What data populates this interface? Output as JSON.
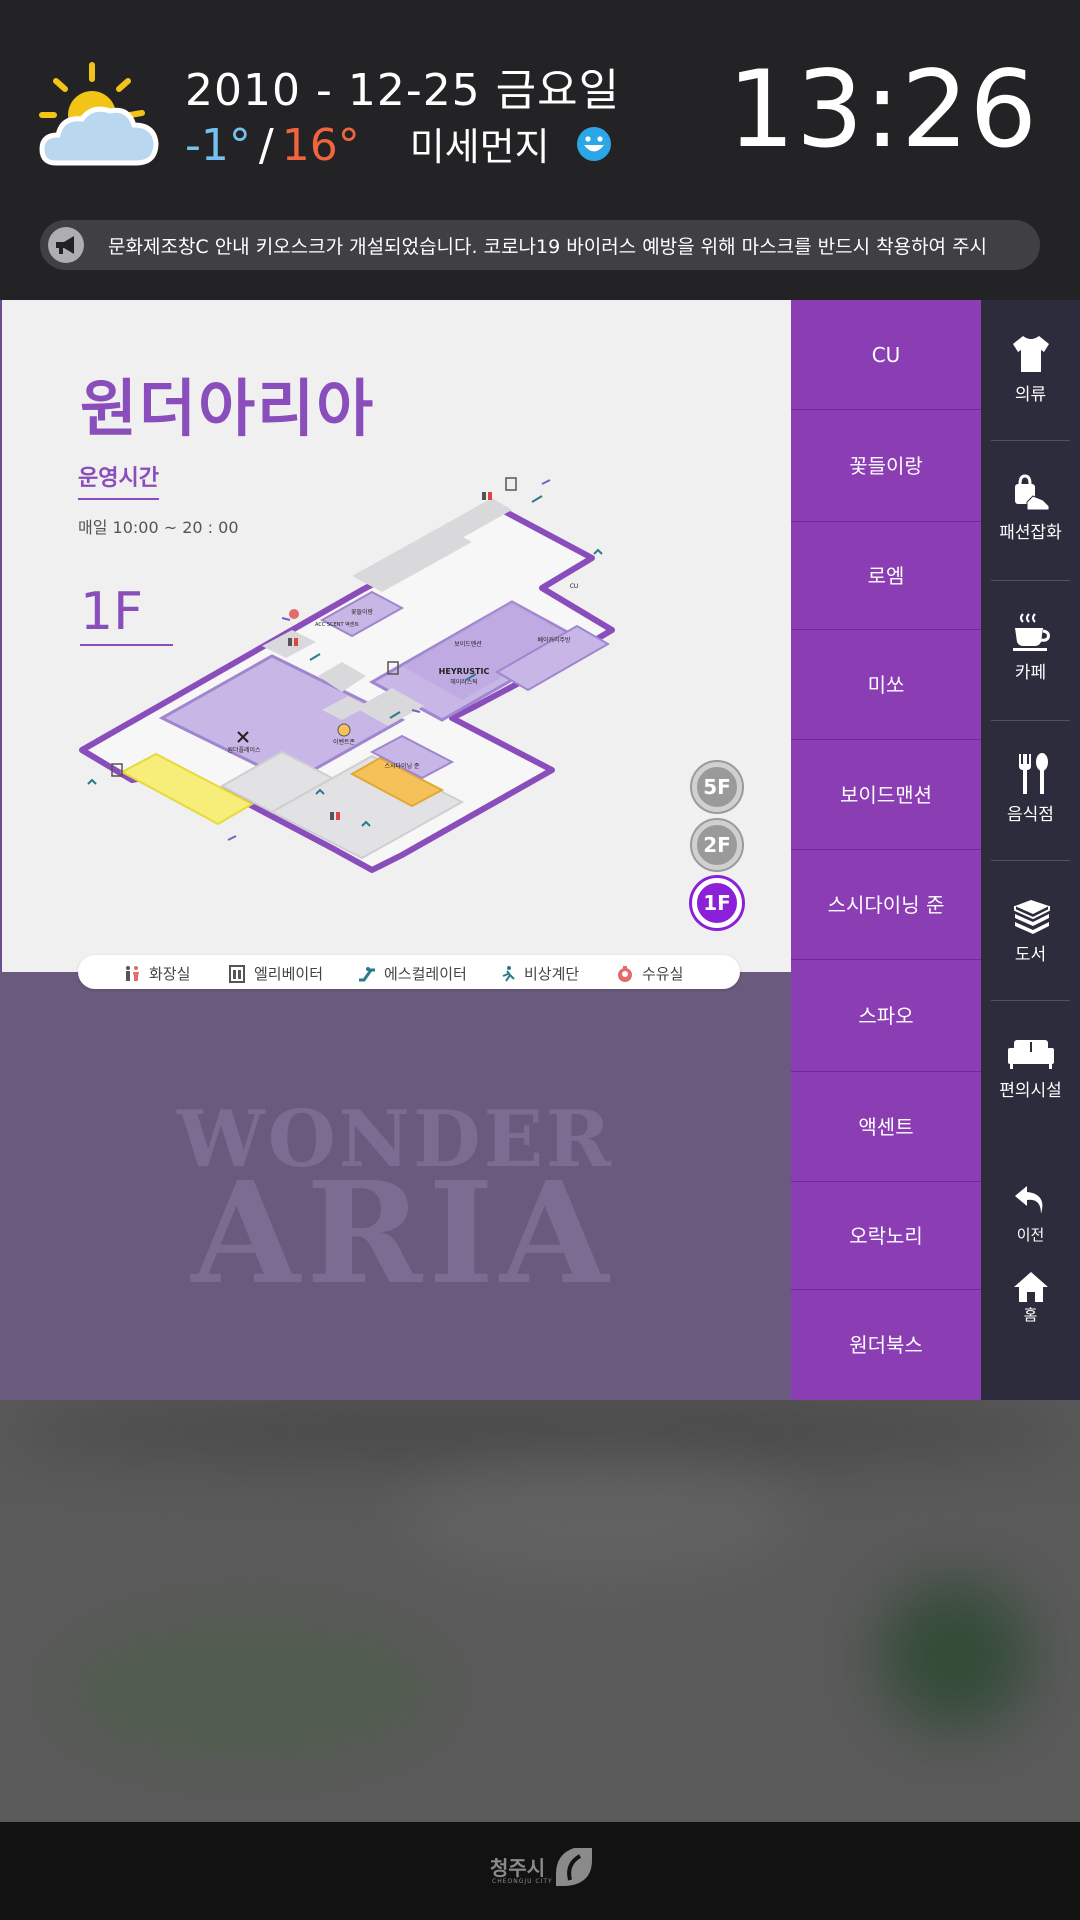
{
  "header": {
    "date": "2010 - 12-25  금요일",
    "temp_low": "-1°",
    "temp_sep": "/",
    "temp_high": "16°",
    "dust_label": "미세먼지",
    "clock": "13:26",
    "notice": "문화제조창C 안내 키오스크가 개설되었습니다. 코로나19 바이러스 예방을 위해 마스크를 반드시 착용하여 주시"
  },
  "shop": {
    "title": "원더아리아",
    "hours_label": "운영시간",
    "hours_value": "매일 10:00 ~ 20 : 00",
    "floor": "1F"
  },
  "map": {
    "labels": {
      "wonder_place": "원더플레이스",
      "boid": "보이드맨션",
      "heyrustic_logo": "HEYRUSTIC",
      "heyrustic": "헤이러스틱",
      "bakery": "베이커리주방",
      "cu": "CU",
      "flower": "꽃들이랑",
      "accent": "ACC SCENT 액센트",
      "event": "이벤트존",
      "sushi": "스시다이닝 준"
    }
  },
  "floors": [
    {
      "label": "5F",
      "active": false
    },
    {
      "label": "2F",
      "active": false
    },
    {
      "label": "1F",
      "active": true
    }
  ],
  "legend": [
    {
      "icon": "restroom-icon",
      "label": "화장실"
    },
    {
      "icon": "elevator-icon",
      "label": "엘리베이터"
    },
    {
      "icon": "escalator-icon",
      "label": "에스컬레이터"
    },
    {
      "icon": "emergency-stairs-icon",
      "label": "비상계단"
    },
    {
      "icon": "nursing-room-icon",
      "label": "수유실"
    }
  ],
  "brand": {
    "line1": "WONDER",
    "line2": "ARIA"
  },
  "stores": [
    "CU",
    "꽃들이랑",
    "로엠",
    "미쏘",
    "보이드맨션",
    "스시다이닝 준",
    "스파오",
    "액센트",
    "오락노리",
    "원더북스"
  ],
  "categories": [
    {
      "icon": "shirt-icon",
      "label": "의류"
    },
    {
      "icon": "fashion-goods-icon",
      "label": "패션잡화"
    },
    {
      "icon": "coffee-cup-icon",
      "label": "카페"
    },
    {
      "icon": "utensils-icon",
      "label": "음식점"
    },
    {
      "icon": "books-icon",
      "label": "도서"
    },
    {
      "icon": "sofa-icon",
      "label": "편의시설"
    }
  ],
  "nav": {
    "back": "이전",
    "home": "홈"
  },
  "footer": {
    "logo_text": "청주시",
    "logo_sub": "CHEONGJU CITY"
  },
  "colors": {
    "accent": "#8b3db3",
    "brand_title": "#8a4dbc",
    "temp_low": "#77c1f0",
    "temp_high": "#f0643e",
    "active_floor": "#8c1fd8"
  }
}
